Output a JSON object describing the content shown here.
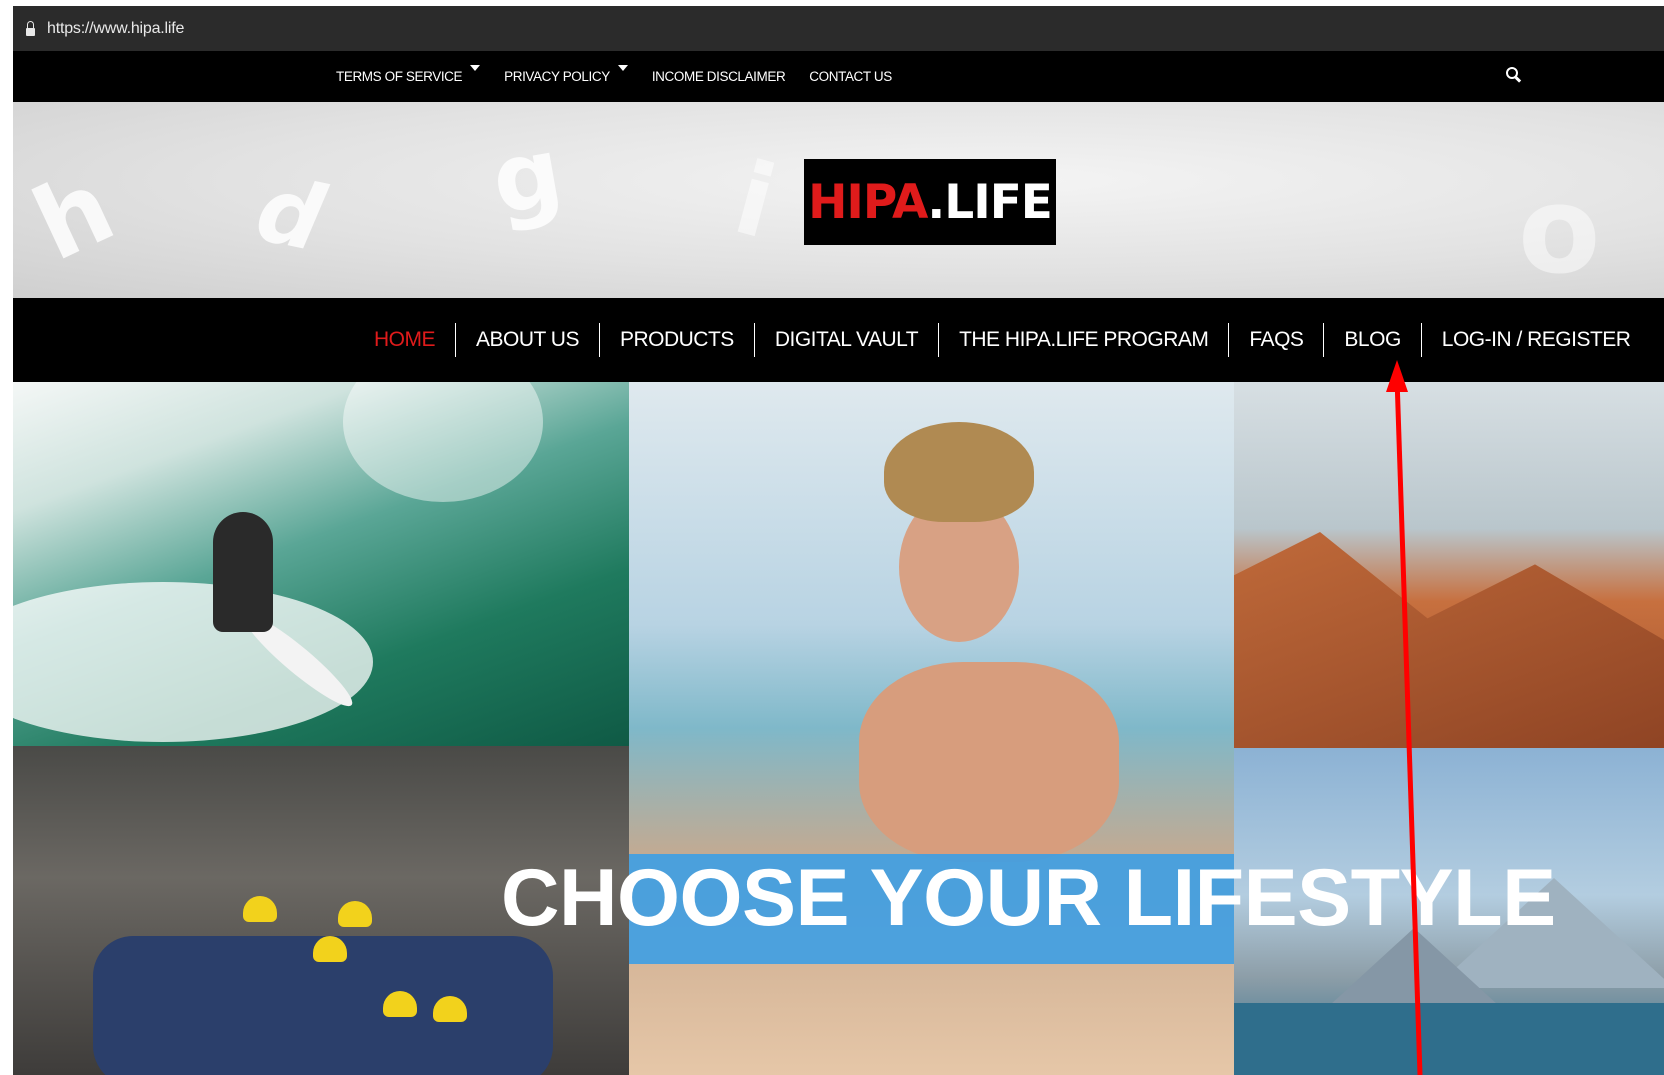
{
  "browser": {
    "url": "https://www.hipa.life"
  },
  "top_menu": [
    {
      "label": "TERMS OF SERVICE",
      "has_dropdown": true
    },
    {
      "label": "PRIVACY POLICY",
      "has_dropdown": true
    },
    {
      "label": "INCOME DISCLAIMER",
      "has_dropdown": false
    },
    {
      "label": "CONTACT US",
      "has_dropdown": false
    }
  ],
  "header": {
    "logo": {
      "part1": "HIPA",
      "part2": ".LIFE"
    },
    "decorative_letters": [
      "h",
      "d",
      "g",
      "i",
      "o"
    ]
  },
  "main_nav": [
    {
      "label": "HOME",
      "active": true
    },
    {
      "label": "ABOUT US"
    },
    {
      "label": "PRODUCTS"
    },
    {
      "label": "DIGITAL VAULT"
    },
    {
      "label": "THE HIPA.LIFE PROGRAM"
    },
    {
      "label": "FAQS"
    },
    {
      "label": "BLOG"
    },
    {
      "label": "LOG-IN / REGISTER"
    }
  ],
  "hero": {
    "headline": "CHOOSE YOUR LIFESTYLE"
  },
  "colors": {
    "accent_red": "#e01b1b",
    "nav_bg": "#000000",
    "band_blue": "#3d9ee4",
    "annotation_arrow": "#ff0000"
  },
  "icons": {
    "search": "search-icon",
    "lock": "lock-icon"
  }
}
